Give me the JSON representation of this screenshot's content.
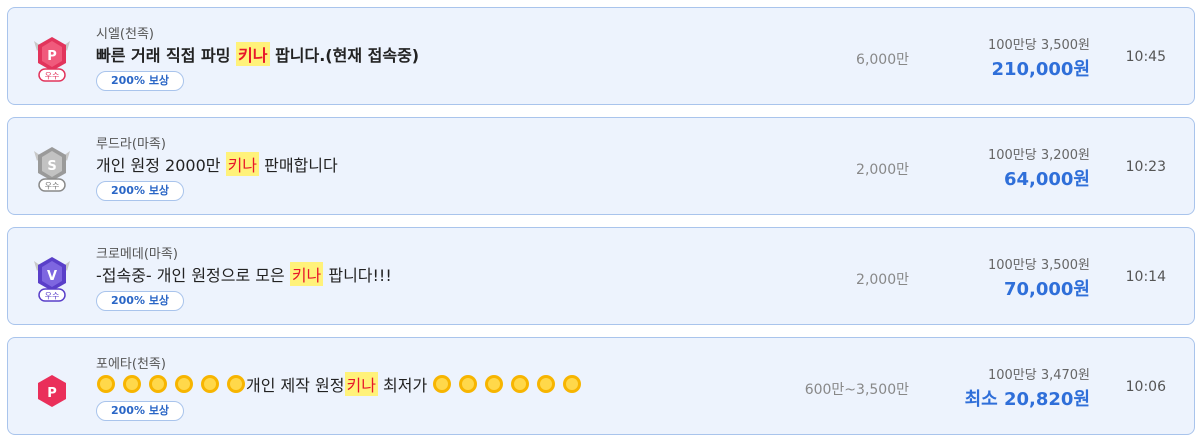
{
  "listings": [
    {
      "badge": {
        "letter": "P",
        "grade": "우수",
        "icon": "pink-grade-badge-icon",
        "color": "#e2345c"
      },
      "server": "시엘(천족)",
      "title_pre": "빠른 거래 직접 파밍 ",
      "keyword": "키나",
      "title_post": " 팝니다.(현재 접속중)",
      "compensation": "200% 보상",
      "quantity": "6,000만",
      "rate": "100만당 3,500원",
      "price": "210,000원",
      "time": "10:45"
    },
    {
      "badge": {
        "letter": "S",
        "grade": "우수",
        "icon": "silver-grade-badge-icon",
        "color": "#9a9a9a"
      },
      "server": "루드라(마족)",
      "title_pre": "개인 원정 2000만 ",
      "keyword": "키나",
      "title_post": " 판매합니다",
      "compensation": "200% 보상",
      "quantity": "2,000만",
      "rate": "100만당 3,200원",
      "price": "64,000원",
      "time": "10:23"
    },
    {
      "badge": {
        "letter": "V",
        "grade": "우수",
        "icon": "purple-grade-badge-icon",
        "color": "#5a3fc9"
      },
      "server": "크로메데(마족)",
      "title_pre": "-접속중- 개인 원정으로 모은 ",
      "keyword": "키나",
      "title_post": " 팝니다!!!",
      "compensation": "200% 보상",
      "quantity": "2,000만",
      "rate": "100만당 3,500원",
      "price": "70,000원",
      "time": "10:14"
    },
    {
      "badge": {
        "letter": "P",
        "grade": "",
        "icon": "pink-power-badge-icon",
        "color": "#ea2f5a"
      },
      "server": "포에타(천족)",
      "title_pre": "개인 제작 원정",
      "keyword": "키나",
      "title_post": " 최저가 ",
      "sun_icons": "sun-emoji-icon",
      "compensation": "200% 보상",
      "quantity": "600만~3,500만",
      "rate": "100만당 3,470원",
      "price": "최소 20,820원",
      "time": "10:06"
    }
  ]
}
